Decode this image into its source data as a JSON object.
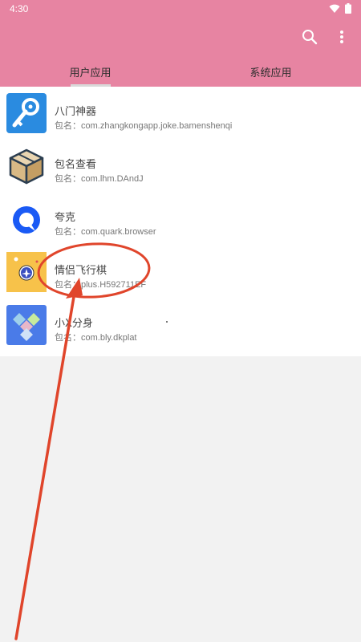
{
  "status": {
    "time": "4:30"
  },
  "toolbar": {
    "search_icon": "search-icon",
    "more_icon": "more-vert-icon"
  },
  "tabs": [
    {
      "label": "用户应用",
      "active": true
    },
    {
      "label": "系统应用",
      "active": false
    }
  ],
  "apps": [
    {
      "name": "八门神器",
      "pkg_label": "包名：",
      "pkg": "com.zhangkongapp.joke.bamenshenqi",
      "icon": "key-wrench-icon"
    },
    {
      "name": "包名查看",
      "pkg_label": "包名：",
      "pkg": "com.lhm.DAndJ",
      "icon": "box-icon"
    },
    {
      "name": "夸克",
      "pkg_label": "包名：",
      "pkg": "com.quark.browser",
      "icon": "quark-icon"
    },
    {
      "name": "情侣飞行棋",
      "pkg_label": "包名：",
      "pkg": "plus.H592711EF",
      "icon": "flight-chess-icon"
    },
    {
      "name": "小X分身",
      "pkg_label": "包名：",
      "pkg": "com.bly.dkplat",
      "icon": "diamond-tiles-icon"
    }
  ],
  "colors": {
    "header": "#e784a2",
    "annotation": "#e0452b"
  }
}
